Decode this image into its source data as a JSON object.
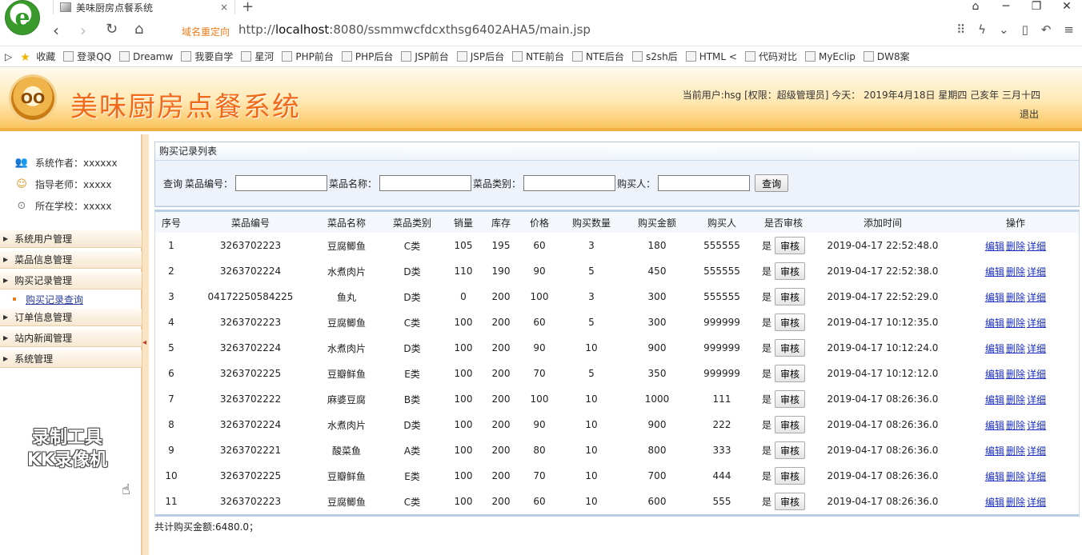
{
  "browser": {
    "logo_letter": "e",
    "tab_title": "美味厨房点餐系统",
    "tab_close": "×",
    "new_tab": "+",
    "window_controls": [
      "⌂",
      "─",
      "❐",
      "✕"
    ],
    "redirect_label": "域名重定向",
    "url_prefix": "http://",
    "url_host": "localhost",
    "url_rest": ":8080/ssmmwcfdcxthsg6402AHA5/main.jsp",
    "bookmarks": [
      "收藏",
      "登录QQ",
      "Dreamw",
      "我要自学",
      "星河",
      "PHP前台",
      "PHP后台",
      "JSP前台",
      "JSP后台",
      "NTE前台",
      "NTE后台",
      "s2sh后",
      "HTML <",
      "代码对比",
      "MyEclip",
      "DW8案"
    ]
  },
  "header": {
    "logo_text": "OO",
    "title": "美味厨房点餐系统",
    "user_info": "当前用户:hsg [权限：超级管理员] 今天： 2019年4月18日 星期四 己亥年 三月十四",
    "logout": "退出"
  },
  "sidebar": {
    "info": [
      {
        "label": "系统作者：xxxxxx",
        "icon": "users-icon"
      },
      {
        "label": "指导老师：xxxxx",
        "icon": "teacher-icon"
      },
      {
        "label": "所在学校：xxxxx",
        "icon": "school-icon"
      }
    ],
    "menu": [
      "系统用户管理",
      "菜品信息管理",
      "购买记录管理",
      "订单信息管理",
      "站内新闻管理",
      "系统管理"
    ],
    "submenu_item": "购买记录查询",
    "watermark_line1": "录制工具",
    "watermark_line2": "KK录像机"
  },
  "main": {
    "panel_title": "购买记录列表",
    "search": {
      "prefix": "查询",
      "code_label": "菜品编号：",
      "name_label": "菜品名称：",
      "category_label": "菜品类别：",
      "buyer_label": "购买人：",
      "button": "查询"
    },
    "columns": [
      "序号",
      "菜品编号",
      "菜品名称",
      "菜品类别",
      "销量",
      "库存",
      "价格",
      "购买数量",
      "购买金额",
      "购买人",
      "是否审核",
      "添加时间",
      "操作"
    ],
    "audit_yes": "是",
    "audit_btn": "审核",
    "ops": [
      "编辑",
      "删除",
      "详细"
    ],
    "rows": [
      [
        "1",
        "3263702223",
        "豆腐鲫鱼",
        "C类",
        "105",
        "195",
        "60",
        "3",
        "180",
        "555555",
        "2019-04-17 22:52:48.0"
      ],
      [
        "2",
        "3263702224",
        "水煮肉片",
        "D类",
        "110",
        "190",
        "90",
        "5",
        "450",
        "555555",
        "2019-04-17 22:52:38.0"
      ],
      [
        "3",
        "04172250584225",
        "鱼丸",
        "D类",
        "0",
        "200",
        "100",
        "3",
        "300",
        "555555",
        "2019-04-17 22:52:29.0"
      ],
      [
        "4",
        "3263702223",
        "豆腐鲫鱼",
        "C类",
        "100",
        "200",
        "60",
        "5",
        "300",
        "999999",
        "2019-04-17 10:12:35.0"
      ],
      [
        "5",
        "3263702224",
        "水煮肉片",
        "D类",
        "100",
        "200",
        "90",
        "10",
        "900",
        "999999",
        "2019-04-17 10:12:24.0"
      ],
      [
        "6",
        "3263702225",
        "豆瓣鲜鱼",
        "E类",
        "100",
        "200",
        "70",
        "5",
        "350",
        "999999",
        "2019-04-17 10:12:12.0"
      ],
      [
        "7",
        "3263702222",
        "麻婆豆腐",
        "B类",
        "100",
        "200",
        "100",
        "10",
        "1000",
        "111",
        "2019-04-17 08:26:36.0"
      ],
      [
        "8",
        "3263702224",
        "水煮肉片",
        "D类",
        "100",
        "200",
        "90",
        "10",
        "900",
        "222",
        "2019-04-17 08:26:36.0"
      ],
      [
        "9",
        "3263702221",
        "酸菜鱼",
        "A类",
        "100",
        "200",
        "80",
        "10",
        "800",
        "333",
        "2019-04-17 08:26:36.0"
      ],
      [
        "10",
        "3263702225",
        "豆瓣鲜鱼",
        "E类",
        "100",
        "200",
        "70",
        "10",
        "700",
        "444",
        "2019-04-17 08:26:36.0"
      ],
      [
        "11",
        "3263702223",
        "豆腐鲫鱼",
        "C类",
        "100",
        "200",
        "60",
        "10",
        "600",
        "555",
        "2019-04-17 08:26:36.0"
      ]
    ],
    "total": "共计购买金额:6480.0；"
  }
}
